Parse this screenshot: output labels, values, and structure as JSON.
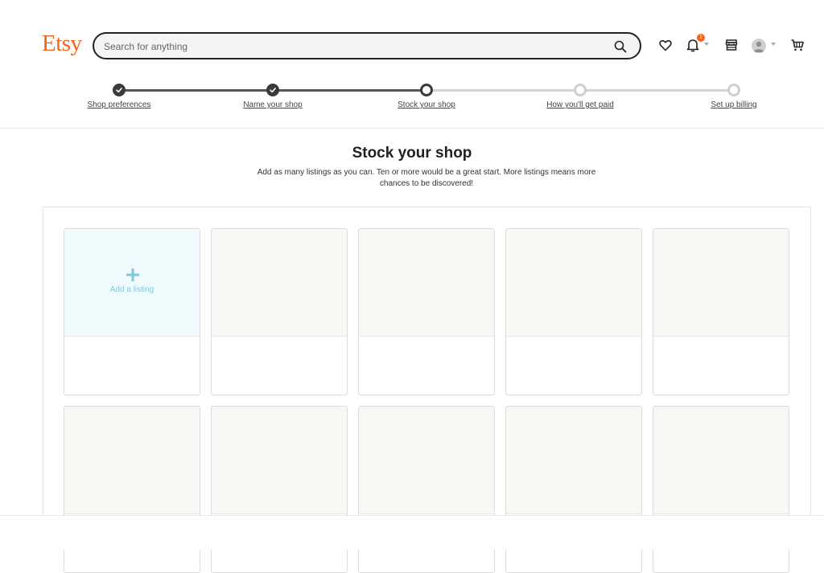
{
  "header": {
    "logo": "Etsy",
    "search_placeholder": "Search for anything",
    "notification_count": "1"
  },
  "stepper": {
    "steps": [
      {
        "label": "Shop preferences",
        "state": "done"
      },
      {
        "label": "Name your shop",
        "state": "done"
      },
      {
        "label": "Stock your shop",
        "state": "current"
      },
      {
        "label": "How you'll get paid",
        "state": "todo"
      },
      {
        "label": "Set up billing",
        "state": "todo"
      }
    ]
  },
  "main": {
    "title": "Stock your shop",
    "subtitle": "Add as many listings as you can. Ten or more would be a great start. More listings means more chances to be discovered!",
    "add_listing_label": "Add a listing"
  },
  "colors": {
    "brand": "#f1641e",
    "add_tile_bg": "#effafc",
    "add_tile_accent": "#7fcad7",
    "step_done": "#3a3a3a",
    "step_todo": "#cfcfcf"
  },
  "icons": {
    "search": "search-icon",
    "favorites": "heart-icon",
    "notifications": "bell-icon",
    "shop_manager": "shop-icon",
    "account": "avatar-icon",
    "cart": "cart-icon",
    "add": "plus-icon"
  }
}
